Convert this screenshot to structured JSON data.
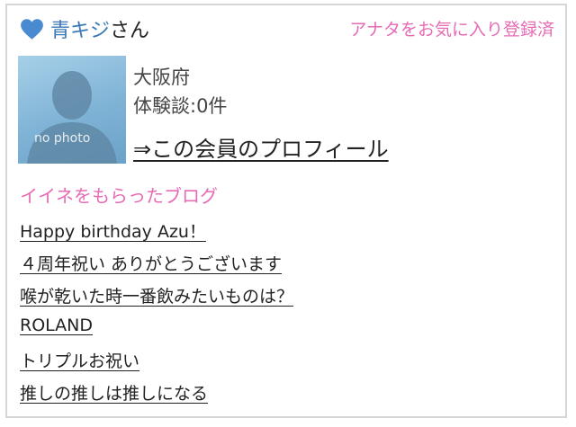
{
  "member": {
    "name": "青キジ",
    "honorific": "さん",
    "favorite_status": "アナタをお気に入り登録済",
    "avatar_text": "no photo",
    "location": "大阪府",
    "experience_label": "体験談:0件",
    "profile_link": "⇒この会員のプロフィール"
  },
  "blogs": {
    "title": "イイネをもらったブログ",
    "items": [
      "Happy birthday Azu！",
      "４周年祝い ありがとうございます",
      "喉が乾いた時一番飲みたいものは？",
      "ROLAND",
      "トリプルお祝い",
      "推しの推しは推しになる"
    ]
  },
  "colors": {
    "accent_pink": "#e66bb5",
    "name_blue": "#3a78b5",
    "heart_blue": "#4a8ad0"
  }
}
